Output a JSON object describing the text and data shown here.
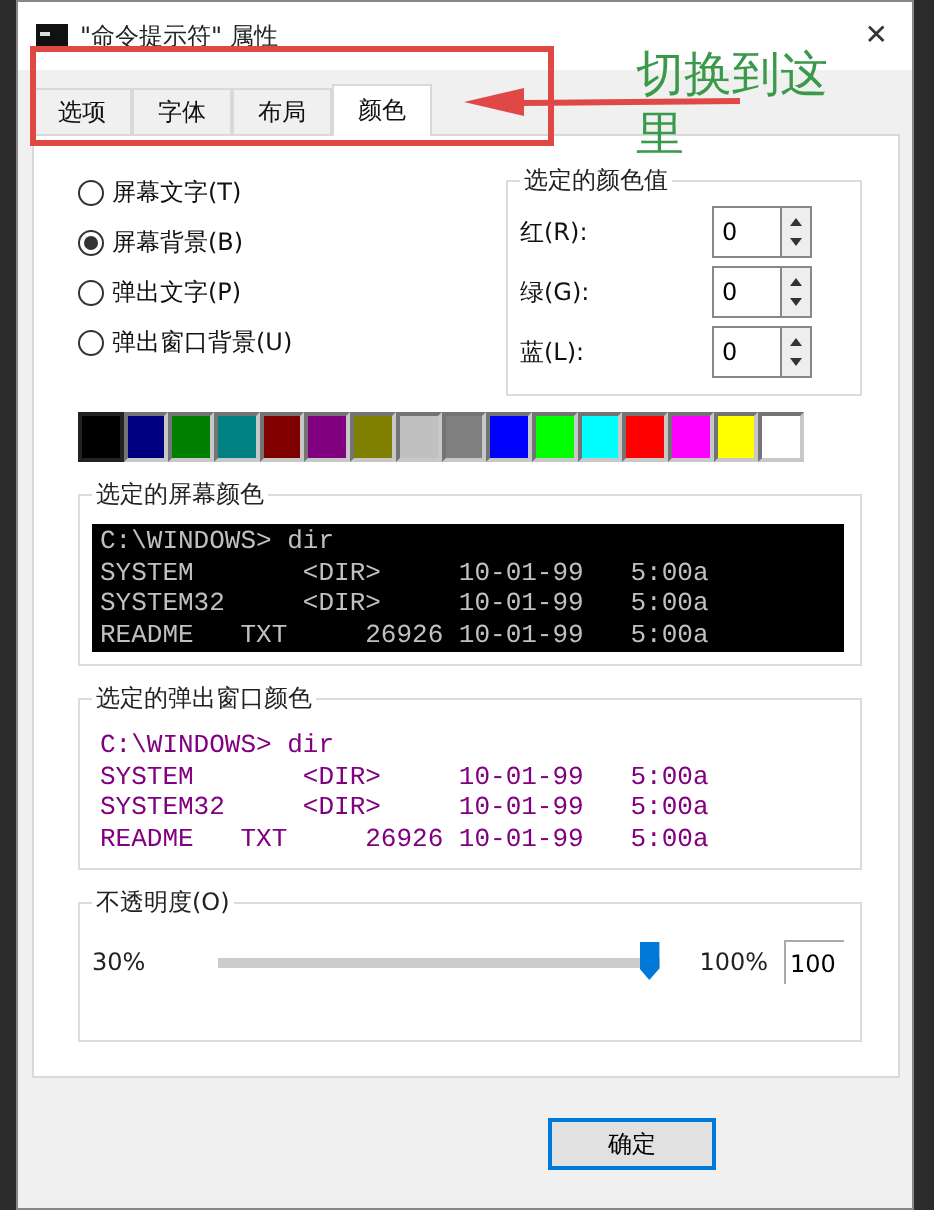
{
  "window": {
    "title": "\"命令提示符\" 属性",
    "close": "✕"
  },
  "tabs": [
    {
      "label": "选项",
      "selected": false
    },
    {
      "label": "字体",
      "selected": false
    },
    {
      "label": "布局",
      "selected": false
    },
    {
      "label": "颜色",
      "selected": true
    }
  ],
  "annotation": {
    "text": "切换到这",
    "text_line2": "里"
  },
  "targets": [
    {
      "label": "屏幕文字(T)",
      "selected": false
    },
    {
      "label": "屏幕背景(B)",
      "selected": true
    },
    {
      "label": "弹出文字(P)",
      "selected": false
    },
    {
      "label": "弹出窗口背景(U)",
      "selected": false
    }
  ],
  "color_values": {
    "title": "选定的颜色值",
    "fields": [
      {
        "label": "红(R):",
        "value": "0"
      },
      {
        "label": "绿(G):",
        "value": "0"
      },
      {
        "label": "蓝(L):",
        "value": "0"
      }
    ]
  },
  "palette": [
    {
      "color": "#000000",
      "selected": true
    },
    {
      "color": "#000080",
      "selected": false
    },
    {
      "color": "#008000",
      "selected": false
    },
    {
      "color": "#008080",
      "selected": false
    },
    {
      "color": "#800000",
      "selected": false
    },
    {
      "color": "#800080",
      "selected": false
    },
    {
      "color": "#808000",
      "selected": false
    },
    {
      "color": "#c0c0c0",
      "selected": false
    },
    {
      "color": "#808080",
      "selected": false
    },
    {
      "color": "#0000ff",
      "selected": false
    },
    {
      "color": "#00ff00",
      "selected": false
    },
    {
      "color": "#00ffff",
      "selected": false
    },
    {
      "color": "#ff0000",
      "selected": false
    },
    {
      "color": "#ff00ff",
      "selected": false
    },
    {
      "color": "#ffff00",
      "selected": false
    },
    {
      "color": "#ffffff",
      "selected": false
    }
  ],
  "screen_preview": {
    "title": "选定的屏幕颜色",
    "color": "#c0c0c0",
    "backdrop": {
      "color": "#000000"
    },
    "lines": [
      "C:\\WINDOWS> dir",
      "SYSTEM       <DIR>     10-01-99   5:00a",
      "SYSTEM32     <DIR>     10-01-99   5:00a",
      "README   TXT     26926 10-01-99   5:00a"
    ]
  },
  "popup_preview": {
    "title": "选定的弹出窗口颜色",
    "color": "#800080",
    "backdrop": {
      "color": "#ffffff"
    },
    "lines": [
      "C:\\WINDOWS> dir",
      "SYSTEM       <DIR>     10-01-99   5:00a",
      "SYSTEM32     <DIR>     10-01-99   5:00a",
      "README   TXT     26926 10-01-99   5:00a"
    ]
  },
  "opacity": {
    "title": "不透明度(O)",
    "min_label": "30%",
    "max_label": "100%",
    "level": 1,
    "value": "100"
  },
  "buttons": [
    {
      "label": "确定"
    }
  ]
}
